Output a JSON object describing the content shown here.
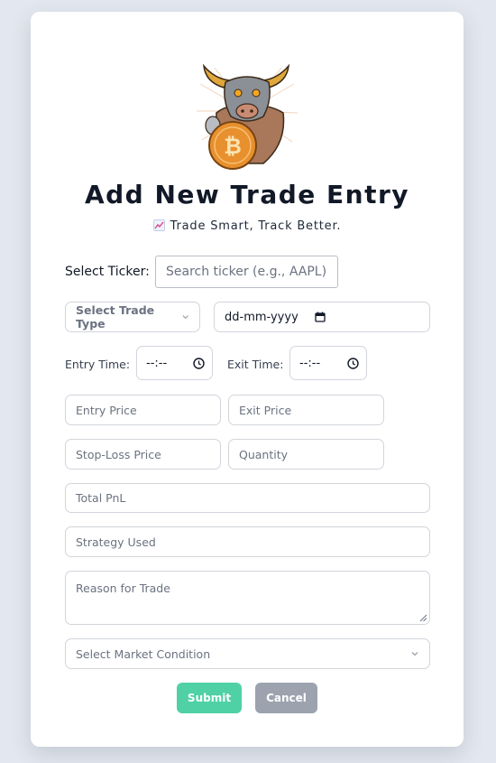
{
  "header": {
    "logo_icon": "bull-bitcoin-mascot-icon",
    "title": "Add New Trade Entry",
    "subtitle": "Trade Smart, Track Better.",
    "subtitle_icon": "chart-increasing-icon"
  },
  "form": {
    "ticker_label": "Select Ticker:",
    "ticker_placeholder": "Search ticker (e.g., AAPL)",
    "trade_type_selected": "Select Trade Type",
    "date_value": "dd-mm-yyyy",
    "entry_time_label": "Entry Time:",
    "entry_time_value": "--:--",
    "exit_time_label": "Exit Time:",
    "exit_time_value": "--:--",
    "entry_price_placeholder": "Entry Price",
    "exit_price_placeholder": "Exit Price",
    "stop_loss_placeholder": "Stop-Loss Price",
    "quantity_placeholder": "Quantity",
    "total_pnl_placeholder": "Total PnL",
    "strategy_placeholder": "Strategy Used",
    "reason_placeholder": "Reason for Trade",
    "market_condition_selected": "Select Market Condition"
  },
  "buttons": {
    "submit_label": "Submit",
    "cancel_label": "Cancel"
  },
  "colors": {
    "page_background": "#e3e8f0",
    "card_background": "#ffffff",
    "submit": "#4fd1a5",
    "cancel": "#9ca3af",
    "field_border": "#d1d5db"
  }
}
